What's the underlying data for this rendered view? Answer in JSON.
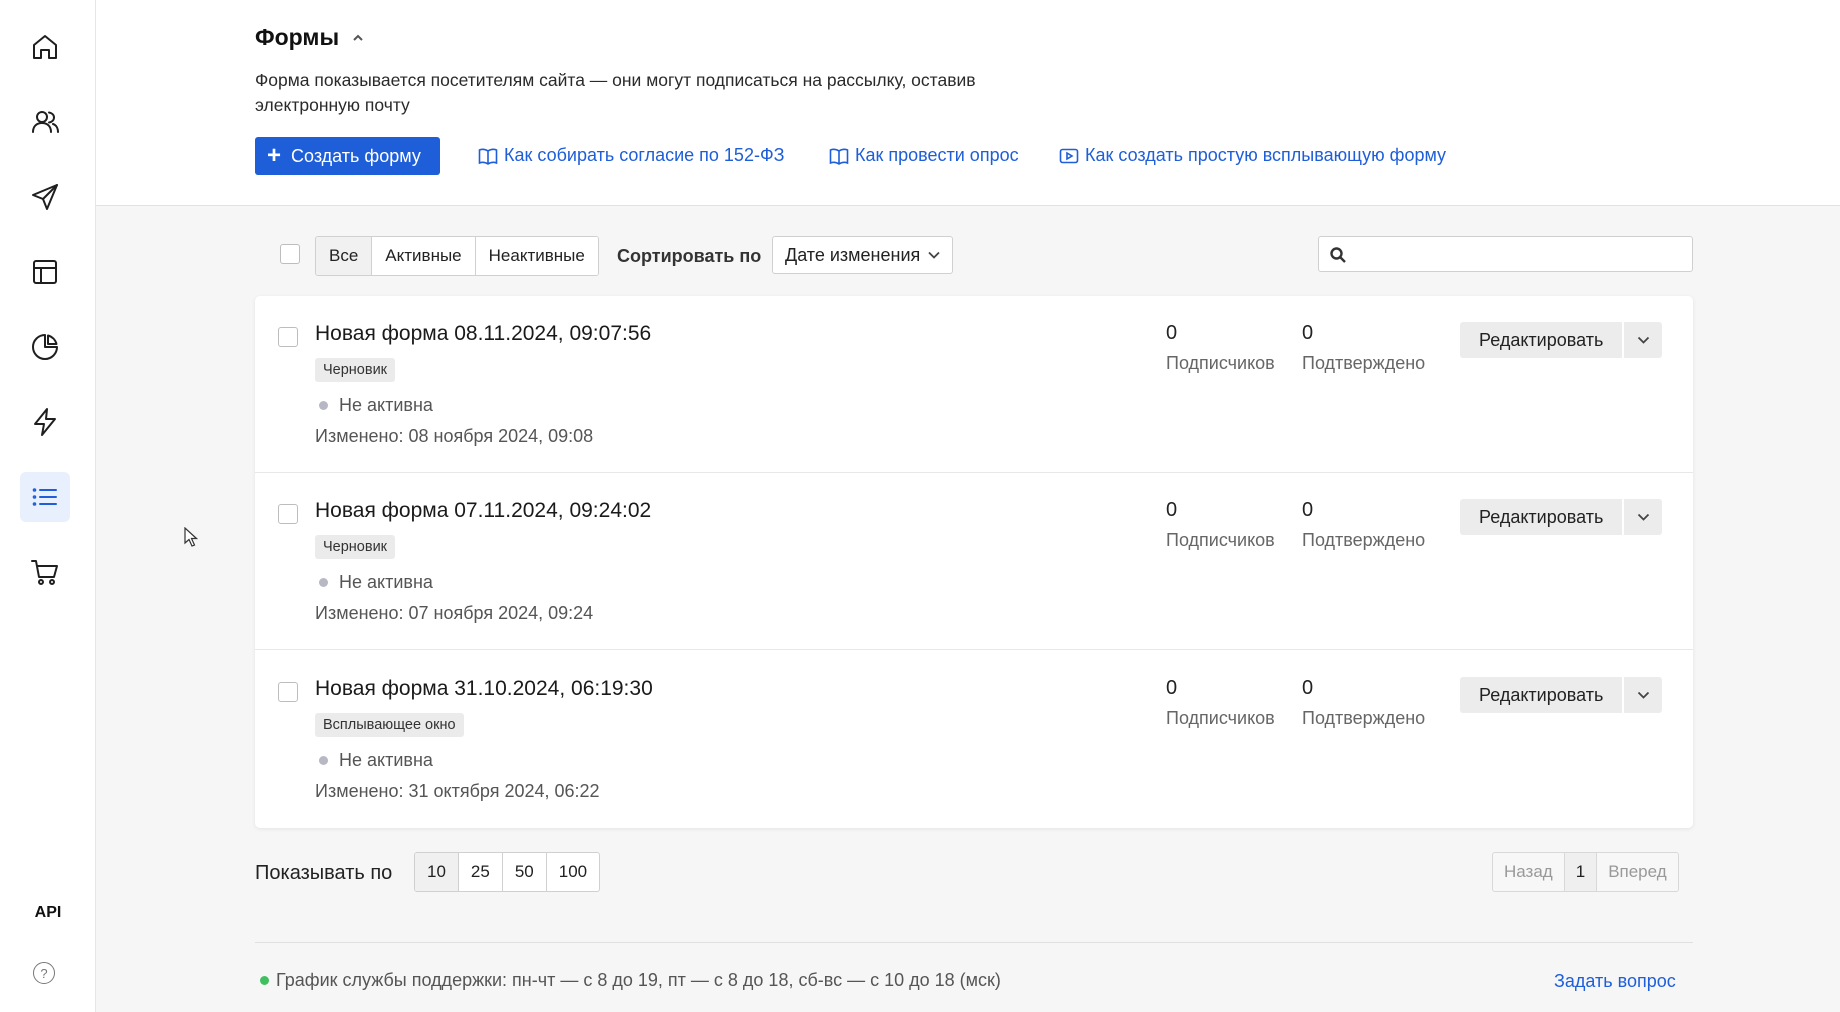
{
  "sidebar": {
    "items": [
      {
        "icon": "home-icon",
        "active": false
      },
      {
        "icon": "users-icon",
        "active": false
      },
      {
        "icon": "send-icon",
        "active": false
      },
      {
        "icon": "layout-icon",
        "active": false
      },
      {
        "icon": "pie-chart-icon",
        "active": false
      },
      {
        "icon": "lightning-icon",
        "active": false
      },
      {
        "icon": "list-icon",
        "active": true
      },
      {
        "icon": "cart-icon",
        "active": false
      }
    ],
    "api_label": "API",
    "help_label": "?"
  },
  "header": {
    "title": "Формы",
    "description": "Форма показывается посетителям сайта — они могут подписаться на рассылку, оставив электронную почту",
    "create_label": "Создать форму",
    "links": [
      {
        "icon": "book-icon",
        "label": "Как собирать согласие по 152-ФЗ"
      },
      {
        "icon": "book-icon",
        "label": "Как провести опрос"
      },
      {
        "icon": "video-icon",
        "label": "Как создать простую всплывающую форму"
      }
    ]
  },
  "toolbar": {
    "filters": [
      {
        "label": "Все",
        "active": true
      },
      {
        "label": "Активные",
        "active": false
      },
      {
        "label": "Неактивные",
        "active": false
      }
    ],
    "sort_label": "Сортировать по",
    "sort_value": "Дате изменения",
    "search_placeholder": ""
  },
  "forms": [
    {
      "name": "Новая форма 08.11.2024, 09:07:56",
      "tag": "Черновик",
      "status": "Не активна",
      "modified": "Изменено: 08 ноября 2024, 09:08",
      "subscribers": "0",
      "subscribers_label": "Подписчиков",
      "confirmed": "0",
      "confirmed_label": "Подтверждено",
      "edit_label": "Редактировать"
    },
    {
      "name": "Новая форма 07.11.2024, 09:24:02",
      "tag": "Черновик",
      "status": "Не активна",
      "modified": "Изменено: 07 ноября 2024, 09:24",
      "subscribers": "0",
      "subscribers_label": "Подписчиков",
      "confirmed": "0",
      "confirmed_label": "Подтверждено",
      "edit_label": "Редактировать"
    },
    {
      "name": "Новая форма 31.10.2024, 06:19:30",
      "tag": "Всплывающее окно",
      "status": "Не активна",
      "modified": "Изменено: 31 октября 2024, 06:22",
      "subscribers": "0",
      "subscribers_label": "Подписчиков",
      "confirmed": "0",
      "confirmed_label": "Подтверждено",
      "edit_label": "Редактировать"
    }
  ],
  "pagination": {
    "per_page_label": "Показывать по",
    "per_page_options": [
      {
        "label": "10",
        "active": true
      },
      {
        "label": "25",
        "active": false
      },
      {
        "label": "50",
        "active": false
      },
      {
        "label": "100",
        "active": false
      }
    ],
    "prev_label": "Назад",
    "current_page": "1",
    "next_label": "Вперед"
  },
  "footer": {
    "support_text": "График службы поддержки: пн-чт — с 8 до 19, пт — с 8 до 18, сб-вс — с 10 до 18 (мск)",
    "ask_label": "Задать вопрос"
  },
  "colors": {
    "accent": "#1e5ed8",
    "status_inactive": "#b8b8c4",
    "support_online": "#3fbf5f"
  }
}
